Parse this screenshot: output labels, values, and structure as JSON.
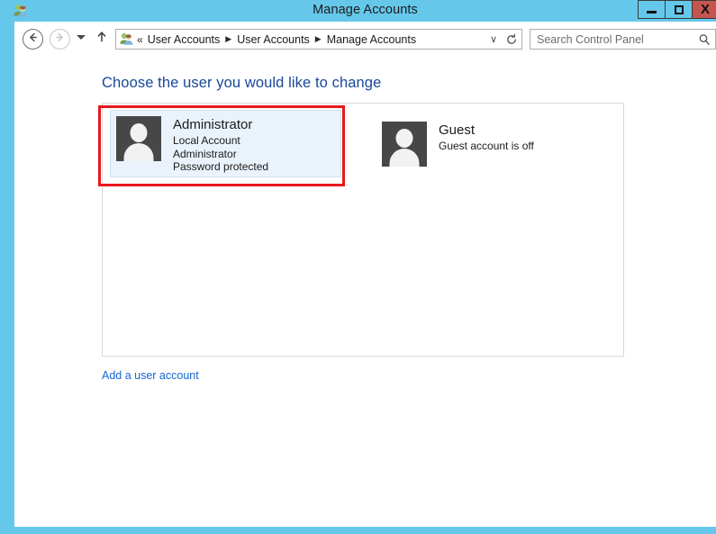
{
  "window": {
    "title": "Manage Accounts",
    "icon": "user-accounts-icon",
    "frame_color": "#65c8ea",
    "controls": {
      "minimize": "–",
      "maximize": "□",
      "close": "X",
      "close_color": "#c4564f"
    }
  },
  "navbar": {
    "back": "back-arrow-icon",
    "forward": "forward-arrow-icon",
    "recent_dropdown": "chevron-down-icon",
    "up": "up-arrow-icon",
    "address": {
      "icon": "user-accounts-icon",
      "overflow": "«",
      "crumbs": [
        {
          "label": "User Accounts"
        },
        {
          "label": "User Accounts"
        },
        {
          "label": "Manage Accounts"
        }
      ],
      "separator": "▶",
      "dropdown": "∨",
      "refresh": "refresh-icon"
    },
    "search": {
      "placeholder": "Search Control Panel",
      "value": "",
      "icon": "search-icon"
    }
  },
  "main": {
    "heading": "Choose the user you would like to change",
    "heading_color": "#18479b",
    "accounts": [
      {
        "name": "Administrator",
        "details": [
          "Local Account",
          "Administrator",
          "Password protected"
        ],
        "selected": true,
        "avatar": "user-avatar-icon"
      },
      {
        "name": "Guest",
        "details": [
          "Guest account is off"
        ],
        "selected": false,
        "avatar": "user-avatar-icon"
      }
    ],
    "add_user_link": "Add a user account",
    "link_color": "#1267cf",
    "annotation": {
      "shape": "rectangle",
      "color": "#e8191b",
      "target": "Administrator"
    }
  }
}
